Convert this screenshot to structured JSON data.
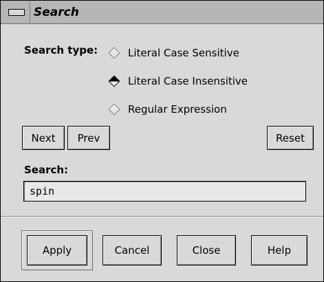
{
  "window": {
    "title": "Search"
  },
  "search_type": {
    "label": "Search type:",
    "options": [
      {
        "label": "Literal Case Sensitive",
        "selected": false
      },
      {
        "label": "Literal Case Insensitive",
        "selected": true
      },
      {
        "label": "Regular Expression",
        "selected": false
      }
    ]
  },
  "nav": {
    "next_label": "Next",
    "prev_label": "Prev",
    "reset_label": "Reset"
  },
  "search": {
    "label": "Search:",
    "value": "spin"
  },
  "actions": {
    "apply_label": "Apply",
    "cancel_label": "Cancel",
    "close_label": "Close",
    "help_label": "Help"
  }
}
